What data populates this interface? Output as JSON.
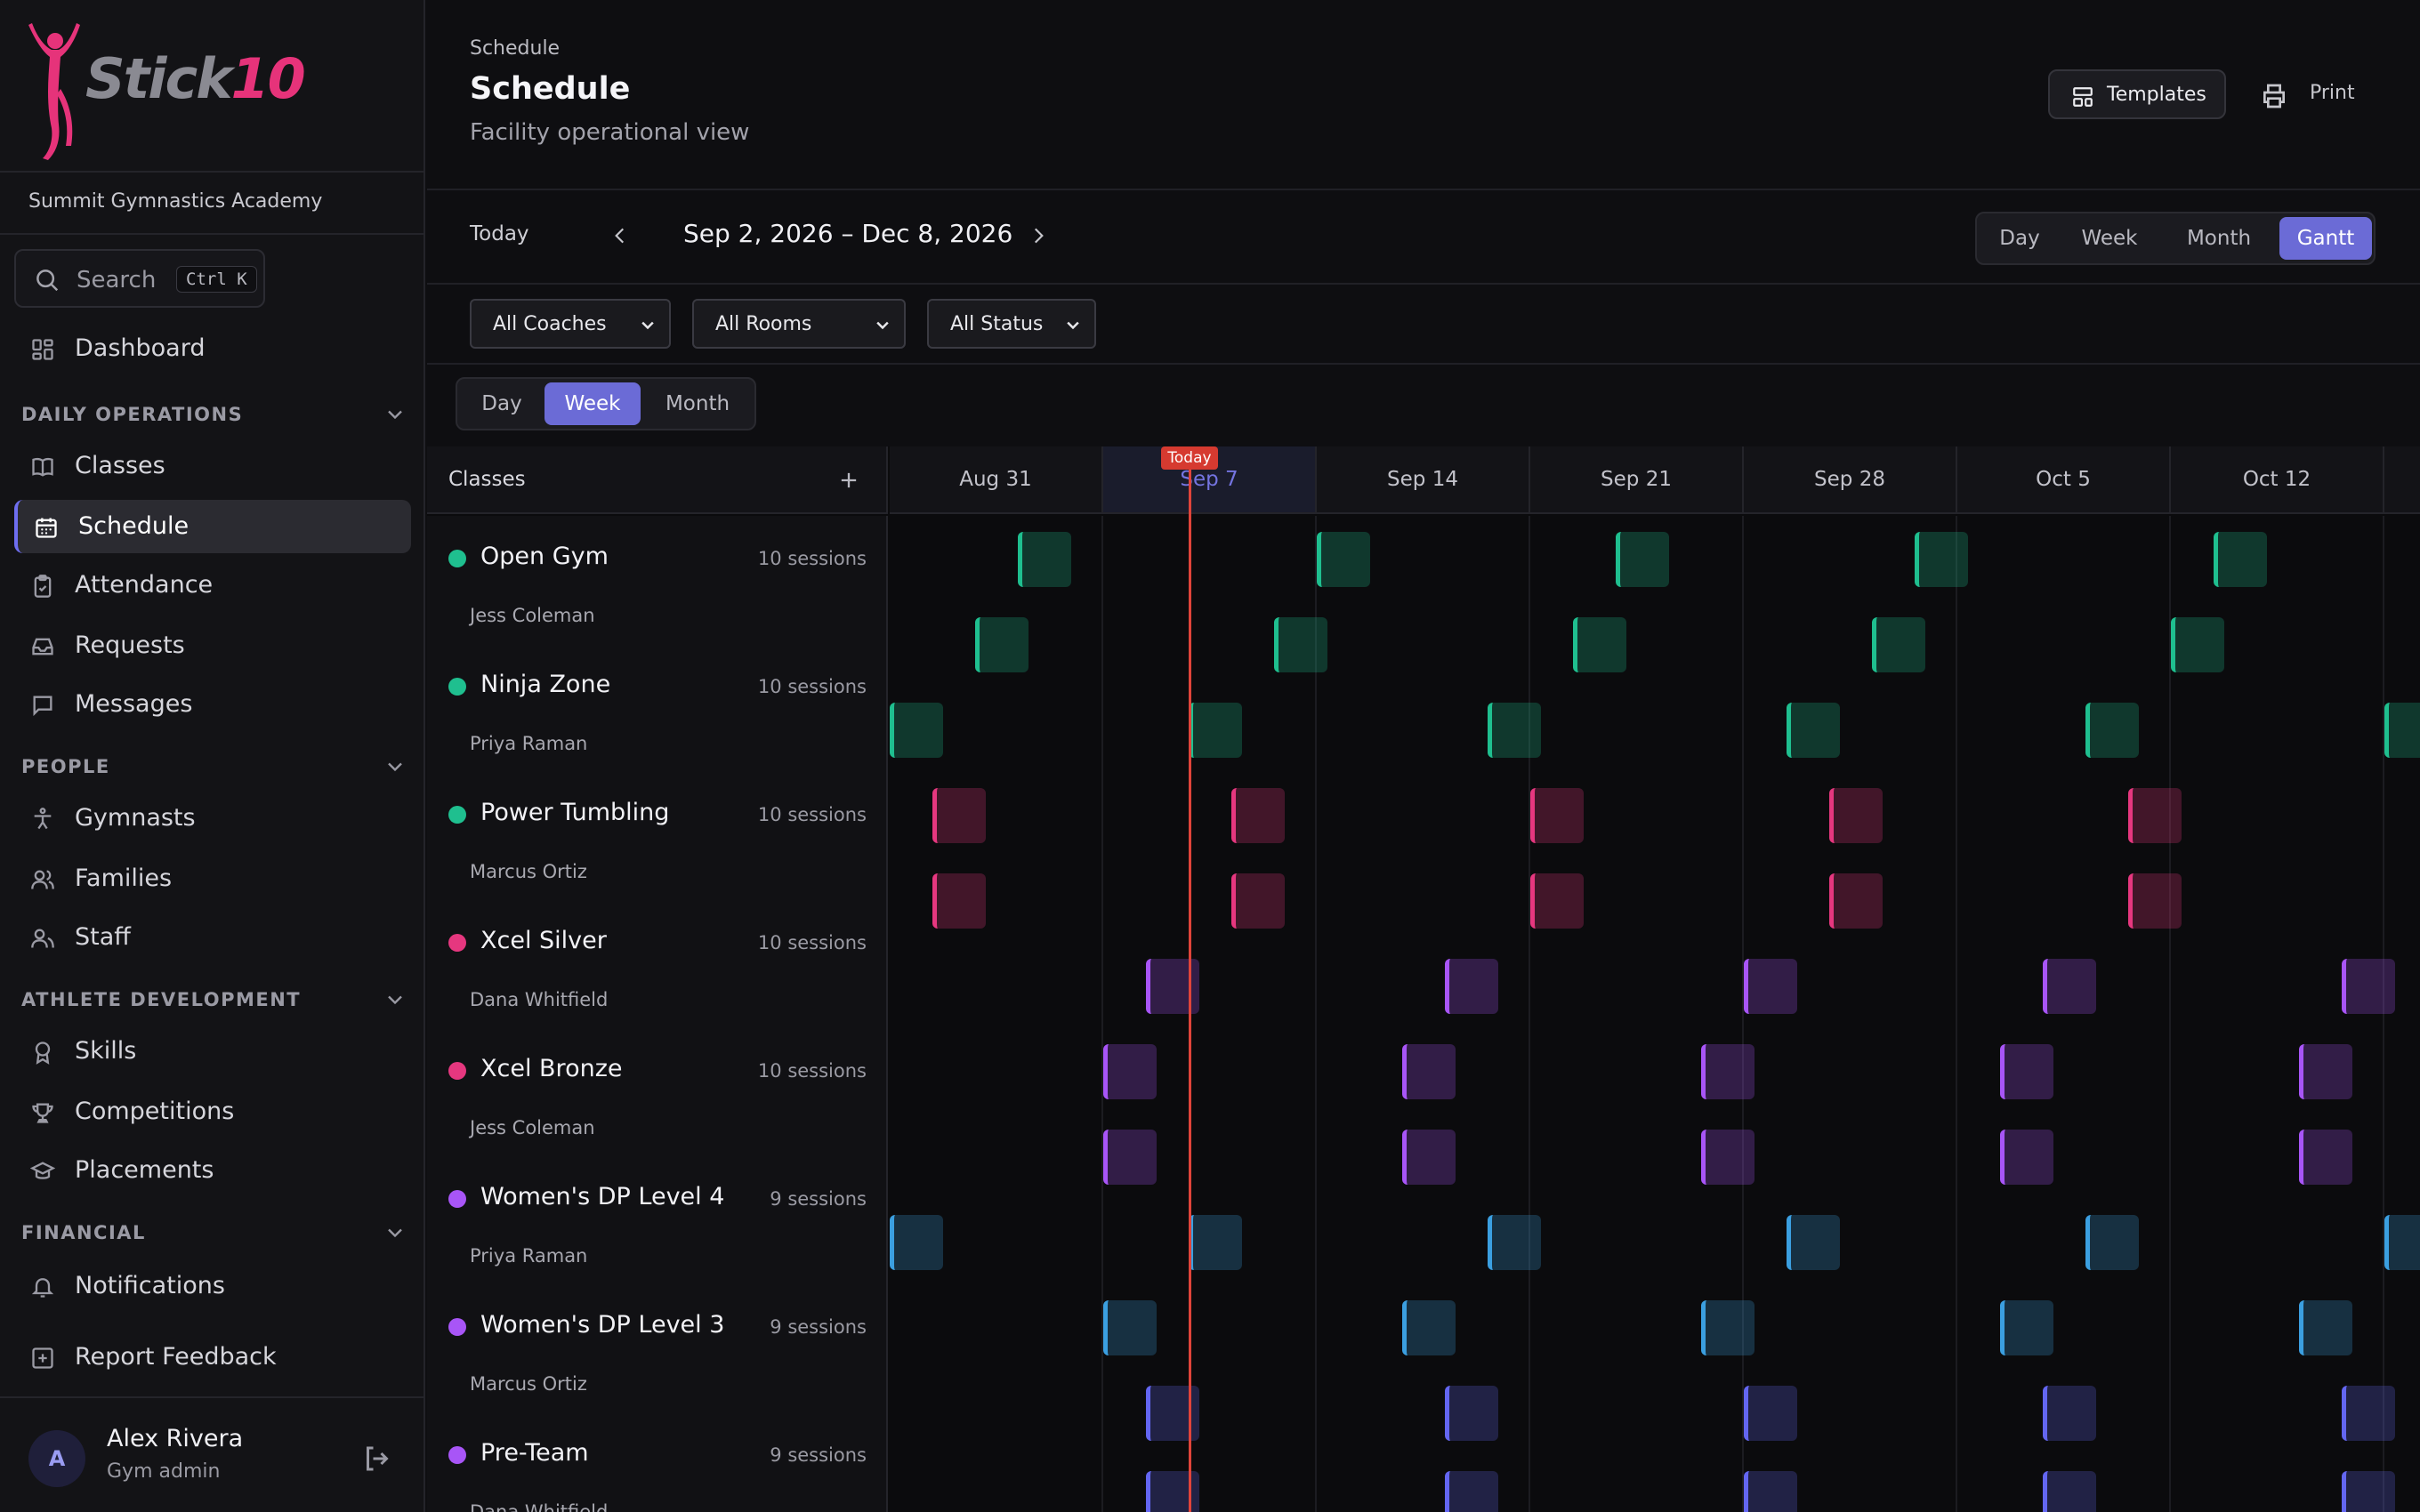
{
  "app": {
    "brand": "Stick",
    "brand_num": "10",
    "org": "Summit Gymnastics Academy"
  },
  "search": {
    "label": "Search",
    "shortcut": "Ctrl K"
  },
  "nav": {
    "dashboard": "Dashboard",
    "daily_ops": {
      "title": "DAILY OPERATIONS",
      "items": [
        "Classes",
        "Schedule",
        "Attendance",
        "Requests",
        "Messages"
      ]
    },
    "people": {
      "title": "PEOPLE",
      "items": [
        "Gymnasts",
        "Families",
        "Staff"
      ]
    },
    "athlete_dev": {
      "title": "ATHLETE DEVELOPMENT",
      "items": [
        "Skills",
        "Competitions",
        "Placements"
      ]
    },
    "financial": {
      "title": "FINANCIAL",
      "items": [
        "Notifications"
      ]
    },
    "feedback": "Report Feedback",
    "active": "Schedule"
  },
  "user": {
    "initial": "A",
    "name": "Alex Rivera",
    "role": "Gym admin"
  },
  "header": {
    "breadcrumb": "Schedule",
    "title": "Schedule",
    "subtitle": "Facility operational view",
    "templates": "Templates",
    "print": "Print"
  },
  "toolbar": {
    "today": "Today",
    "range": "Sep 2, 2026 – Dec 8, 2026",
    "views": [
      "Day",
      "Week",
      "Month",
      "Gantt"
    ],
    "active_view": "Gantt"
  },
  "filters": {
    "coaches": "All Coaches",
    "rooms": "All Rooms",
    "status": "All Status"
  },
  "zoom": {
    "options": [
      "Day",
      "Week",
      "Month"
    ],
    "active": "Week"
  },
  "gantt": {
    "header_label": "Classes",
    "today_label": "Today",
    "weeks": [
      "Aug 31",
      "Sep 7",
      "Sep 14",
      "Sep 21",
      "Sep 28",
      "Oct 5",
      "Oct 12"
    ],
    "current_week": "Sep 7",
    "classes": [
      {
        "name": "Open Gym",
        "coach": "Jess Coleman",
        "sessions": "10 sessions",
        "color": "#1fbf8f"
      },
      {
        "name": "Ninja Zone",
        "coach": "Priya Raman",
        "sessions": "10 sessions",
        "color": "#1fbf8f"
      },
      {
        "name": "Power Tumbling",
        "coach": "Marcus Ortiz",
        "sessions": "10 sessions",
        "color": "#1fbf8f"
      },
      {
        "name": "Xcel Silver",
        "coach": "Dana Whitfield",
        "sessions": "10 sessions",
        "color": "#e6377f"
      },
      {
        "name": "Xcel Bronze",
        "coach": "Jess Coleman",
        "sessions": "10 sessions",
        "color": "#e6377f"
      },
      {
        "name": "Women's DP Level 4",
        "coach": "Priya Raman",
        "sessions": "9 sessions",
        "color": "#a855f7"
      },
      {
        "name": "Women's DP Level 3",
        "coach": "Marcus Ortiz",
        "sessions": "9 sessions",
        "color": "#a855f7"
      },
      {
        "name": "Pre-Team",
        "coach": "Dana Whitfield",
        "sessions": "9 sessions",
        "color": "#a855f7"
      }
    ]
  },
  "colors": {
    "green": "#1fbf8f",
    "pink": "#e6377f",
    "purple": "#a855f7",
    "blue": "#3b9fe0",
    "indigo": "#6366f1",
    "accent": "#6b6bd6",
    "today": "#e0443a"
  }
}
